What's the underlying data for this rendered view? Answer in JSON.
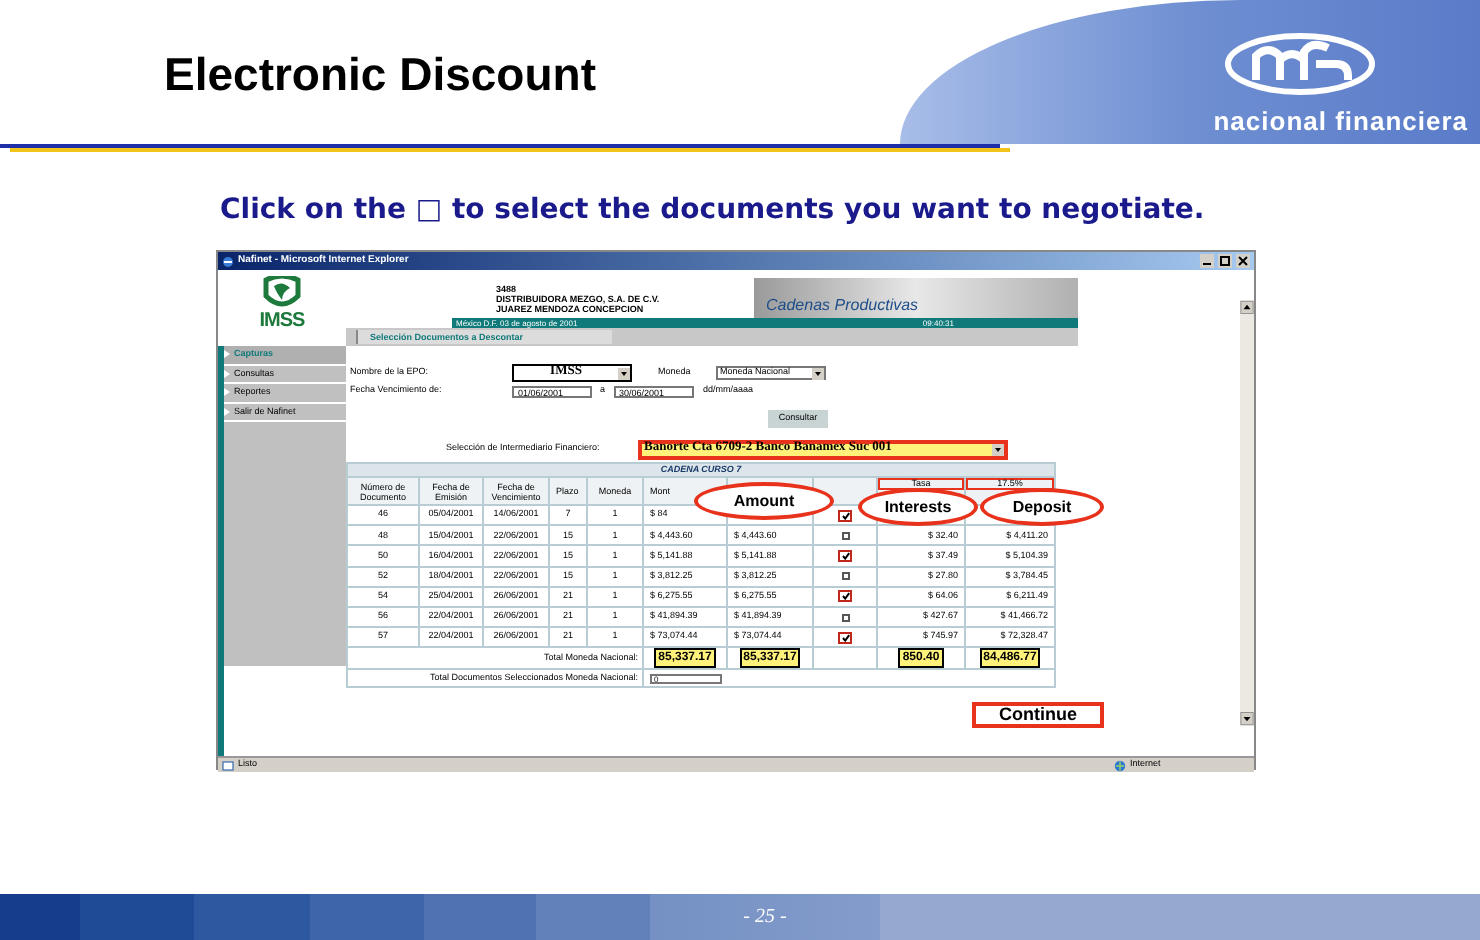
{
  "slide": {
    "title": "Electronic Discount",
    "brand": "nacional financiera",
    "instruction": "Click on the □ to select the documents you want to negotiate.",
    "page": "- 25 -"
  },
  "browser": {
    "title": "Nafinet - Microsoft Internet Explorer",
    "status_left": "Listo",
    "status_right": "Internet"
  },
  "site": {
    "logo_text": "IMSS",
    "company": [
      "3488",
      "DISTRIBUIDORA MEZGO, S.A. DE C.V.",
      "JUAREZ MENDOZA CONCEPCION"
    ],
    "banner": "Cadenas Productivas",
    "date": "México D.F. 03 de agosto de 2001",
    "time": "09:40:31",
    "section_tab": "Selección Documentos a Descontar"
  },
  "sidebar": {
    "items": [
      {
        "label": "Capturas",
        "selected": true
      },
      {
        "label": "Consultas",
        "selected": false
      },
      {
        "label": "Reportes",
        "selected": false
      },
      {
        "label": "Salir de Nafinet",
        "selected": false
      }
    ]
  },
  "form": {
    "epo_label": "Nombre de la EPO:",
    "epo_value": "IMSS",
    "currency_label": "Moneda",
    "currency_value": "Moneda Nacional",
    "date_label": "Fecha Vencimiento de:",
    "date_from": "01/06/2001",
    "date_sep": "a",
    "date_to": "30/06/2001",
    "date_format": "dd/mm/aaaa",
    "query_button": "Consultar",
    "intermediary_label": "Selección de Intermediario Financiero:",
    "intermediary_value": "Banorte Cta 6709-2 Banco Banamex Suc 001"
  },
  "table": {
    "title": "CADENA CURSO 7",
    "rate_label": "Tasa",
    "rate_value": "17.5%",
    "columns": [
      "Número de Documento",
      "Fecha de Emisión",
      "Fecha de Vencimiento",
      "Plazo",
      "Moneda",
      "Mont"
    ],
    "rows": [
      {
        "number": "46",
        "issued": "05/04/2001",
        "due": "14/06/2001",
        "term": "7",
        "currency": "1",
        "amount": "$ 84",
        "checked": true
      },
      {
        "number": "48",
        "issued": "15/04/2001",
        "due": "22/06/2001",
        "term": "15",
        "currency": "1",
        "amount": "$ 4,443.60",
        "amount_2": "$ 4,443.60",
        "checked": false,
        "interest": "$ 32.40",
        "deposit": "$ 4,411.20"
      },
      {
        "number": "50",
        "issued": "16/04/2001",
        "due": "22/06/2001",
        "term": "15",
        "currency": "1",
        "amount": "$ 5,141.88",
        "amount_2": "$ 5,141.88",
        "checked": true,
        "interest": "$ 37.49",
        "deposit": "$ 5,104.39"
      },
      {
        "number": "52",
        "issued": "18/04/2001",
        "due": "22/06/2001",
        "term": "15",
        "currency": "1",
        "amount": "$ 3,812.25",
        "amount_2": "$ 3,812.25",
        "checked": false,
        "interest": "$ 27.80",
        "deposit": "$ 3,784.45"
      },
      {
        "number": "54",
        "issued": "25/04/2001",
        "due": "26/06/2001",
        "term": "21",
        "currency": "1",
        "amount": "$ 6,275.55",
        "amount_2": "$ 6,275.55",
        "checked": true,
        "interest": "$ 64.06",
        "deposit": "$ 6,211.49"
      },
      {
        "number": "56",
        "issued": "22/04/2001",
        "due": "26/06/2001",
        "term": "21",
        "currency": "1",
        "amount": "$ 41,894.39",
        "amount_2": "$ 41,894.39",
        "checked": false,
        "interest": "$ 427.67",
        "deposit": "$ 41,466.72"
      },
      {
        "number": "57",
        "issued": "22/04/2001",
        "due": "26/06/2001",
        "term": "21",
        "currency": "1",
        "amount": "$ 73,074.44",
        "amount_2": "$ 73,074.44",
        "checked": true,
        "interest": "$ 745.97",
        "deposit": "$ 72,328.47"
      }
    ],
    "total_label": "Total Moneda Nacional:",
    "totals": {
      "amount": "85,337.17",
      "amount_2": "85,337.17",
      "interest": "850.40",
      "deposit": "84,486.77"
    },
    "selected_label": "Total Documentos Seleccionados Moneda Nacional:",
    "selected_value": "0"
  },
  "callouts": [
    {
      "label": "Amount"
    },
    {
      "label": "Interests"
    },
    {
      "label": "Deposit"
    }
  ],
  "continue_button": "Continue"
}
